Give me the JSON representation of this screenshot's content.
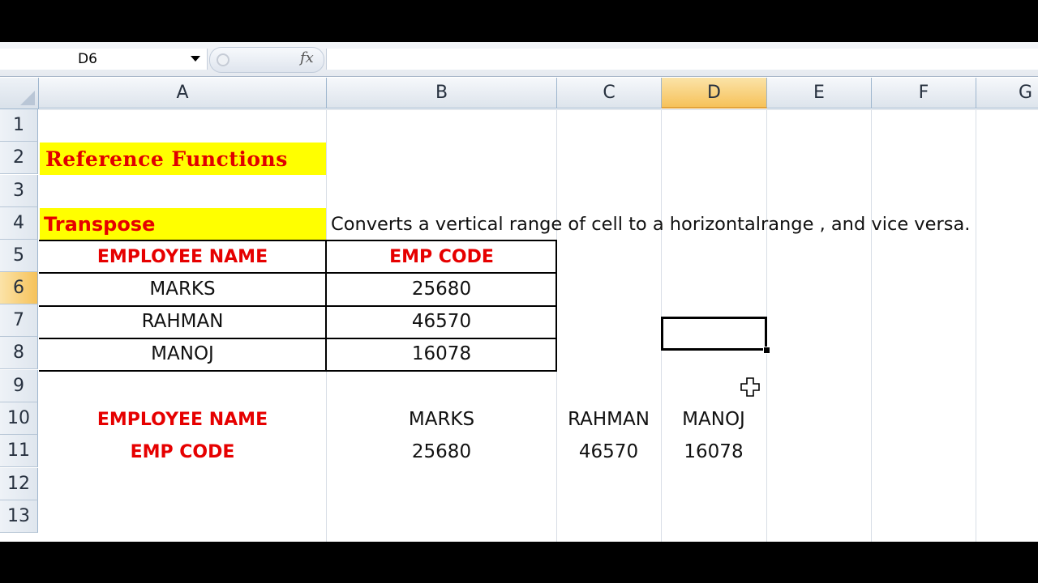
{
  "name_box": {
    "value": "D6"
  },
  "formula_bar": {
    "fx_label": "fx",
    "value": ""
  },
  "columns": [
    "A",
    "B",
    "C",
    "D",
    "E",
    "F",
    "G"
  ],
  "rows": [
    "1",
    "2",
    "3",
    "4",
    "5",
    "6",
    "7",
    "8",
    "9",
    "10",
    "11",
    "12",
    "13"
  ],
  "selected_cell": "D6",
  "cells": {
    "A1": "Reference Functions",
    "A3": "Transpose",
    "B3": "Converts a vertical range of cell to  a horizontalrange , and vice versa.",
    "A4": "EMPLOYEE NAME",
    "B4": "EMP CODE",
    "A5": "MARKS",
    "B5": "25680",
    "A6": "RAHMAN",
    "B6": "46570",
    "A7": "MANOJ",
    "B7": "16078",
    "A9": "EMPLOYEE NAME",
    "B9": "MARKS",
    "C9": "RAHMAN",
    "D9": "MANOJ",
    "A10": "EMP CODE",
    "B10": "25680",
    "C10": "46570",
    "D10": "16078"
  },
  "colors": {
    "highlight": "#ffff00",
    "header_text": "#e60000",
    "selected_header": "#f6c25a"
  }
}
